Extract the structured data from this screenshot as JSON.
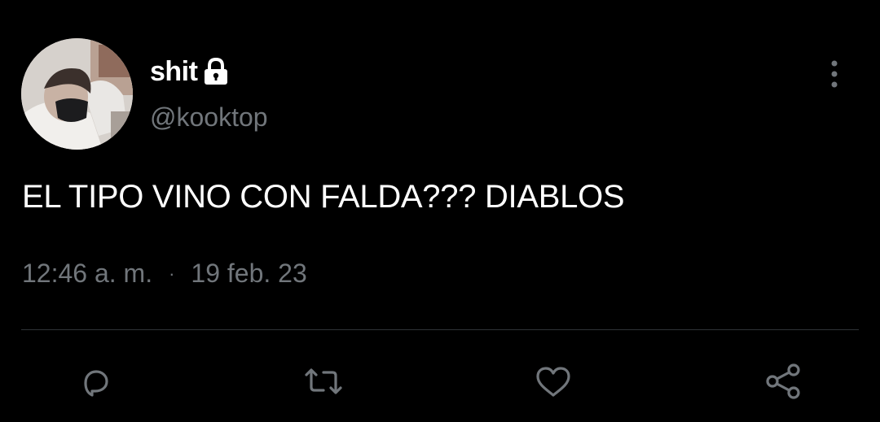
{
  "author": {
    "display_name": "shit",
    "handle": "@kooktop",
    "protected_icon": "lock-icon",
    "avatar_icon": "avatar-photo"
  },
  "tweet": {
    "text": "EL TIPO VINO CON FALDA??? DIABLOS",
    "time": "12:46 a. m.",
    "separator": "·",
    "date": "19 feb. 23"
  },
  "actions": {
    "reply_icon": "reply-icon",
    "retweet_icon": "retweet-icon",
    "like_icon": "heart-icon",
    "share_icon": "share-icon",
    "more_icon": "more-vertical-icon"
  },
  "colors": {
    "background": "#000000",
    "text": "#ffffff",
    "secondary": "#71767b",
    "divider": "#2f3336"
  }
}
